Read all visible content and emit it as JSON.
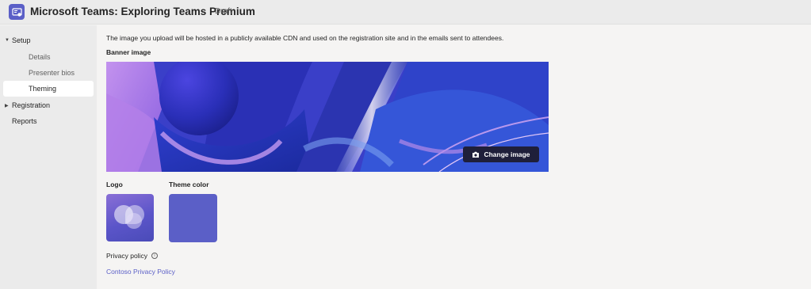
{
  "header": {
    "title": "Microsoft Teams: Exploring Teams Premium",
    "status": "Draft",
    "app_icon": "teams-webinar-icon"
  },
  "sidebar": {
    "items": [
      {
        "label": "Setup",
        "expanded": true,
        "icon": "caret-down-icon"
      },
      {
        "label": "Details"
      },
      {
        "label": "Presenter bios"
      },
      {
        "label": "Theming",
        "selected": true
      },
      {
        "label": "Registration",
        "expanded": false,
        "icon": "caret-right-icon"
      },
      {
        "label": "Reports"
      }
    ]
  },
  "main": {
    "info_text": "The image you upload will be hosted in a publicly available CDN and used on the registration site and in the emails sent to attendees.",
    "banner_label": "Banner image",
    "change_image_label": "Change image",
    "logo_label": "Logo",
    "theme_color_label": "Theme color",
    "theme_color": "#5b5fc7",
    "privacy_label": "Privacy policy",
    "privacy_link": "Contoso Privacy Policy"
  }
}
